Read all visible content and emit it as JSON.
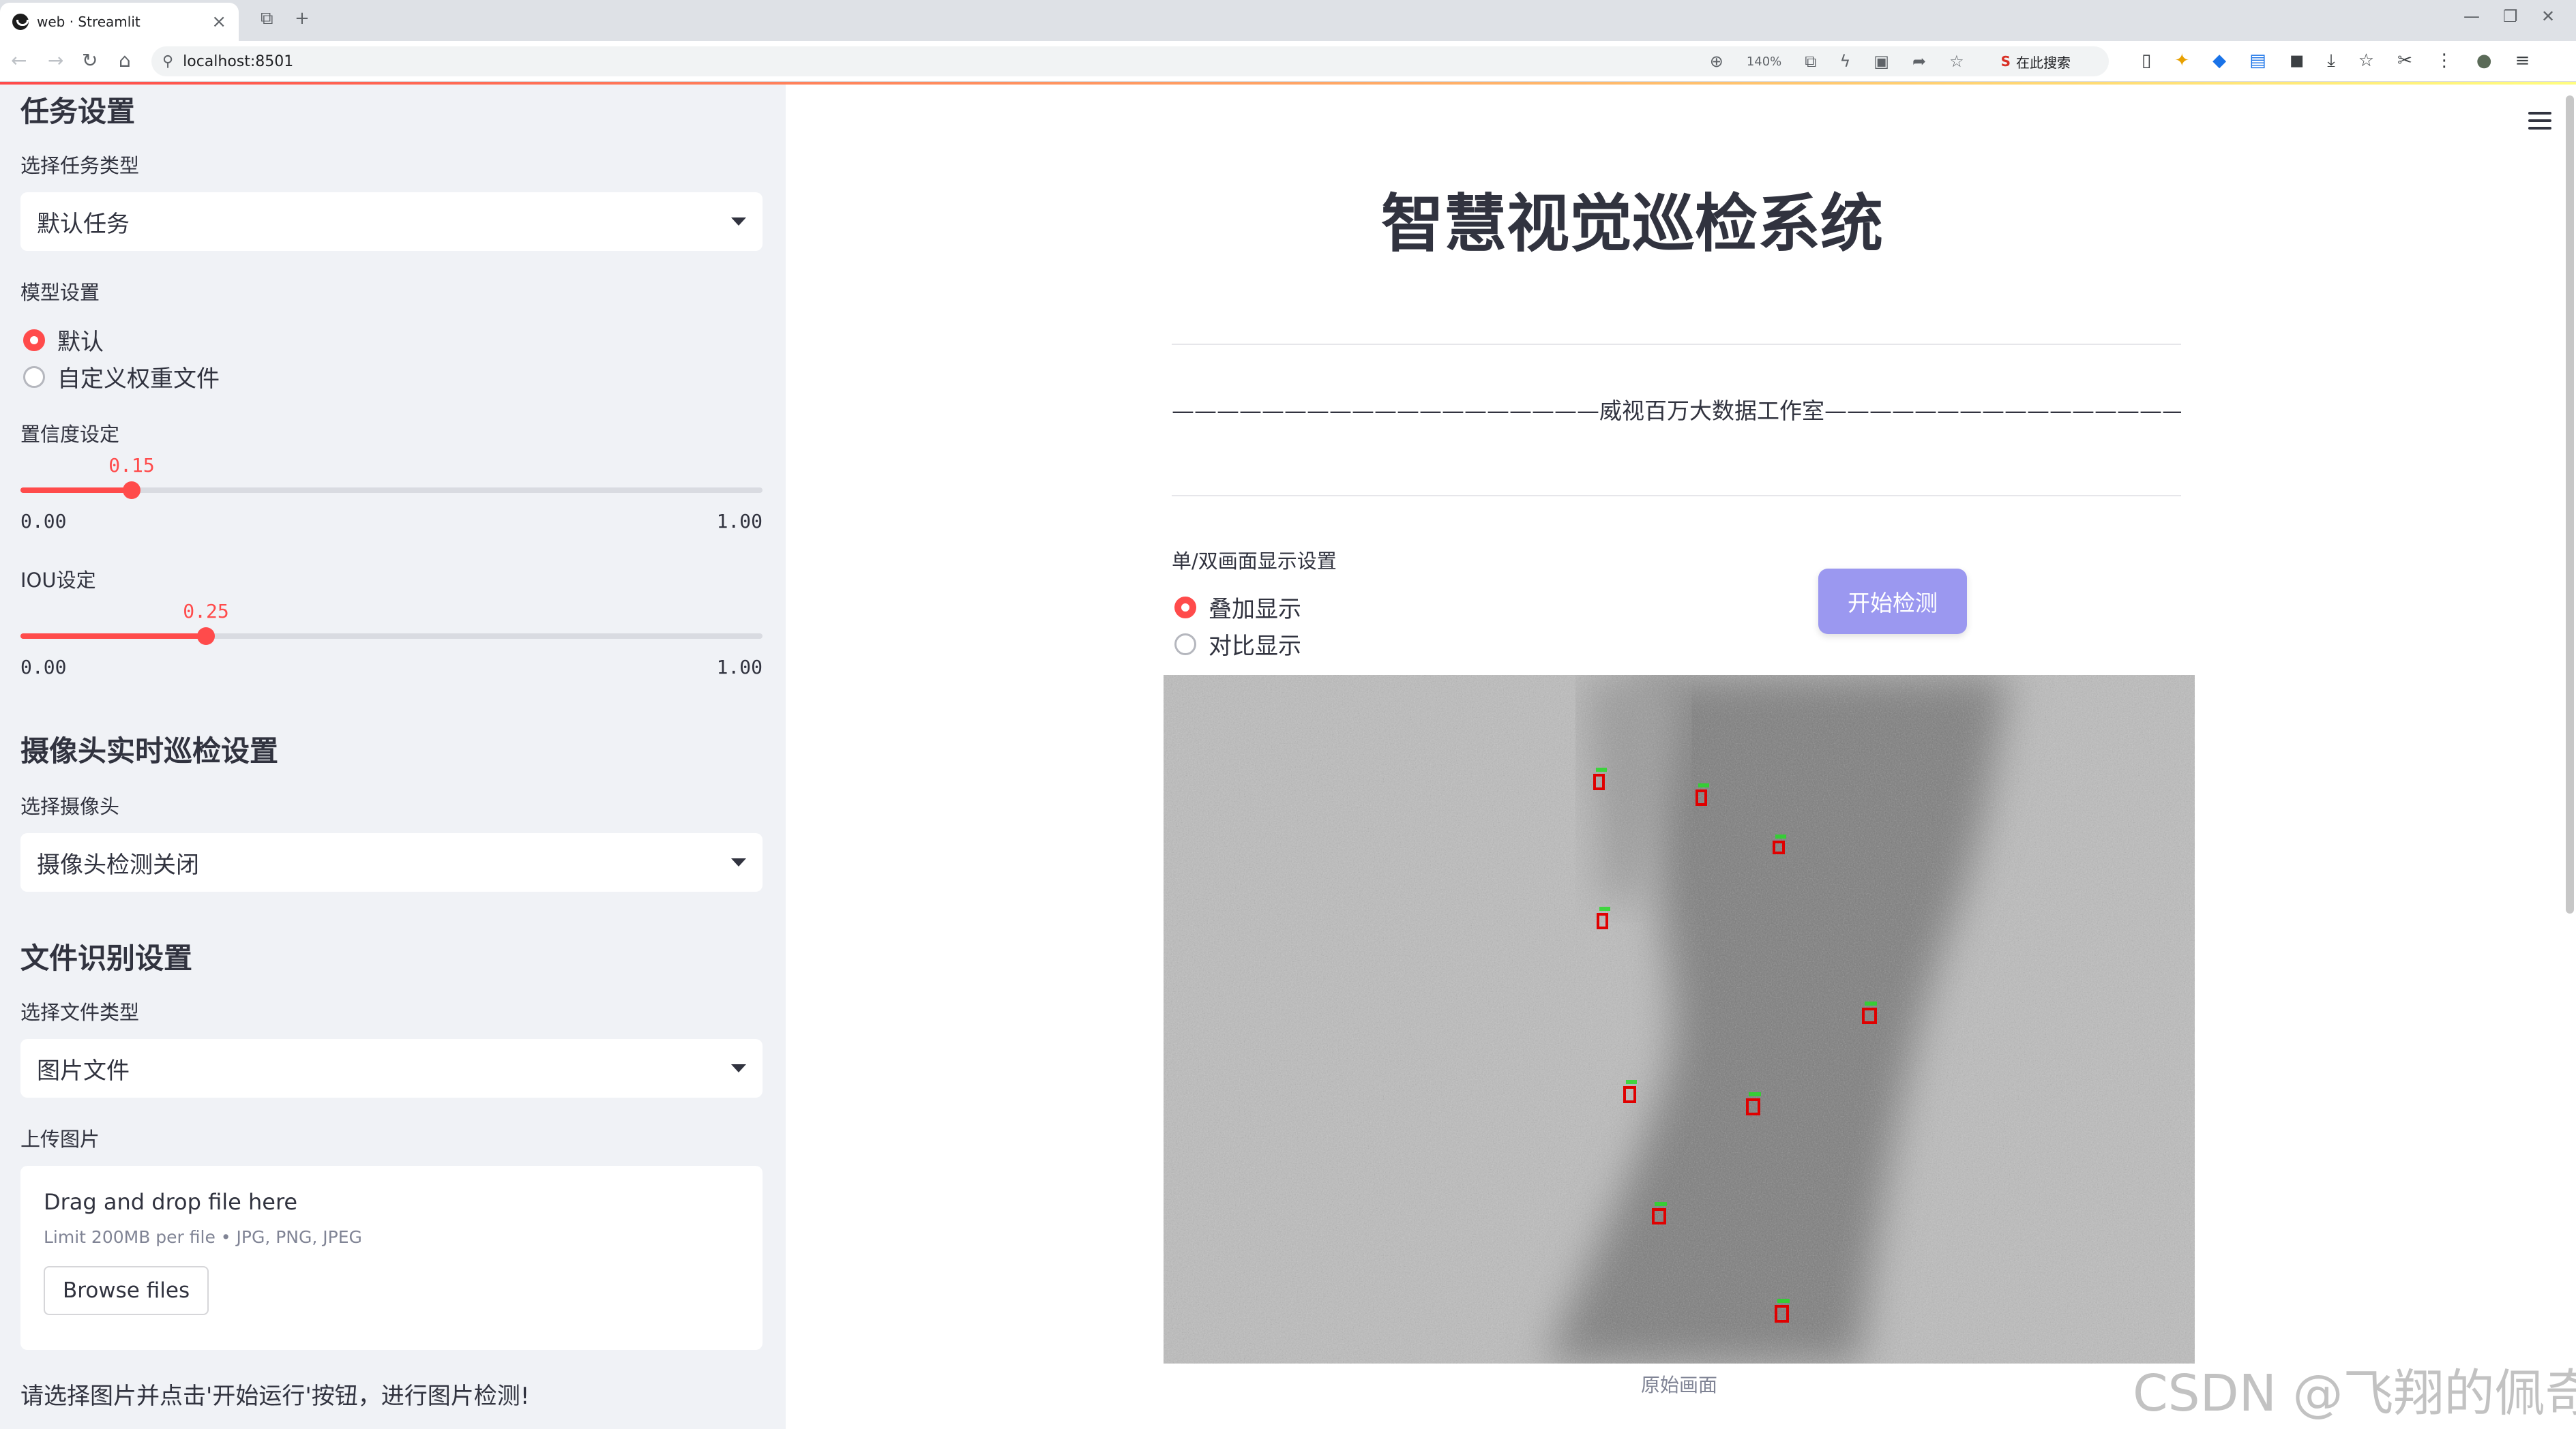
{
  "browser": {
    "tab_title": "web · Streamlit",
    "tab_close": "×",
    "new_tab": "+",
    "url": "localhost:8501",
    "zoom": "140%",
    "search_placeholder": "在此搜索"
  },
  "sidebar": {
    "task_section": "任务设置",
    "task_type_label": "选择任务类型",
    "task_type_value": "默认任务",
    "model_label": "模型设置",
    "model_options": [
      "默认",
      "自定义权重文件"
    ],
    "model_selected": 0,
    "conf_label": "置信度设定",
    "conf": {
      "value": 0.15,
      "value_text": "0.15",
      "min": "0.00",
      "max": "1.00"
    },
    "iou_label": "IOU设定",
    "iou": {
      "value": 0.25,
      "value_text": "0.25",
      "min": "0.00",
      "max": "1.00"
    },
    "camera_section": "摄像头实时巡检设置",
    "camera_label": "选择摄像头",
    "camera_value": "摄像头检测关闭",
    "file_section": "文件识别设置",
    "file_type_label": "选择文件类型",
    "file_type_value": "图片文件",
    "upload_label": "上传图片",
    "uploader": {
      "drag_text": "Drag and drop file here",
      "limit_text": "Limit 200MB per file • JPG, PNG, JPEG",
      "browse_label": "Browse files"
    },
    "hint": "请选择图片并点击'开始运行'按钮，进行图片检测!"
  },
  "main": {
    "title": "智慧视觉巡检系统",
    "subtitle": "———————————————————威视百万大数据工作室————————————————————",
    "display_label": "单/双画面显示设置",
    "display_options": [
      "叠加显示",
      "对比显示"
    ],
    "display_selected": 0,
    "start_button": "开始检测",
    "image_caption": "原始画面",
    "watermark": "CSDN @飞翔的佩奇"
  },
  "colors": {
    "accent": "#ff4b4b",
    "button": "#9b98f0",
    "sidebar_bg": "#f0f2f6",
    "detection_box": "#e00000",
    "detection_label": "#22dd22"
  }
}
